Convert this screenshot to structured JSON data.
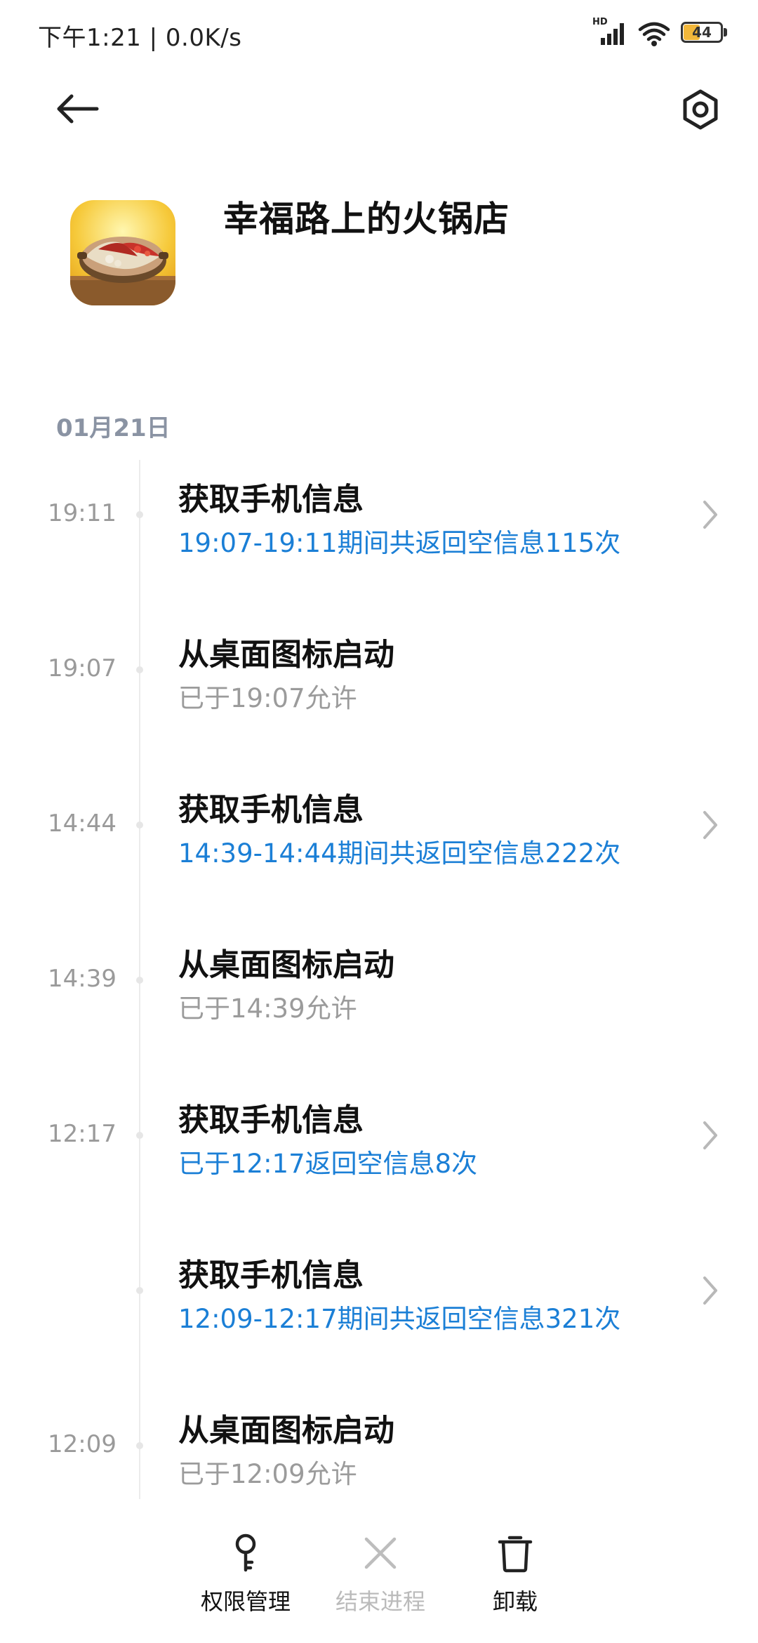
{
  "status_bar": {
    "time_and_speed": "下午1:21 | 0.0K/s",
    "network_tag": "HD",
    "battery_level": "44",
    "battery_fraction": 0.44
  },
  "header": {
    "back_icon": "back-arrow-icon",
    "settings_icon": "settings-icon"
  },
  "app": {
    "name": "幸福路上的火锅店",
    "icon": "hotpot-app-icon"
  },
  "timeline": {
    "date": "01月21日",
    "items": [
      {
        "time": "19:11",
        "title": "获取手机信息",
        "detail": "19:07-19:11期间共返回空信息115次",
        "highlight": true,
        "has_chevron": true
      },
      {
        "time": "19:07",
        "title": "从桌面图标启动",
        "detail": "已于19:07允许",
        "highlight": false,
        "has_chevron": false
      },
      {
        "time": "14:44",
        "title": "获取手机信息",
        "detail": "14:39-14:44期间共返回空信息222次",
        "highlight": true,
        "has_chevron": true
      },
      {
        "time": "14:39",
        "title": "从桌面图标启动",
        "detail": "已于14:39允许",
        "highlight": false,
        "has_chevron": false
      },
      {
        "time": "12:17",
        "title": "获取手机信息",
        "detail": "已于12:17返回空信息8次",
        "highlight": true,
        "has_chevron": true
      },
      {
        "time": "",
        "title": "获取手机信息",
        "detail": "12:09-12:17期间共返回空信息321次",
        "highlight": true,
        "has_chevron": true
      },
      {
        "time": "12:09",
        "title": "从桌面图标启动",
        "detail": "已于12:09允许",
        "highlight": false,
        "has_chevron": false
      }
    ]
  },
  "bottom_bar": {
    "permissions_label": "权限管理",
    "end_process_label": "结束进程",
    "uninstall_label": "卸载"
  },
  "colors": {
    "accent_blue": "#1b7fd6",
    "muted_gray": "#9b9b9b",
    "date_gray": "#8a93a3"
  }
}
